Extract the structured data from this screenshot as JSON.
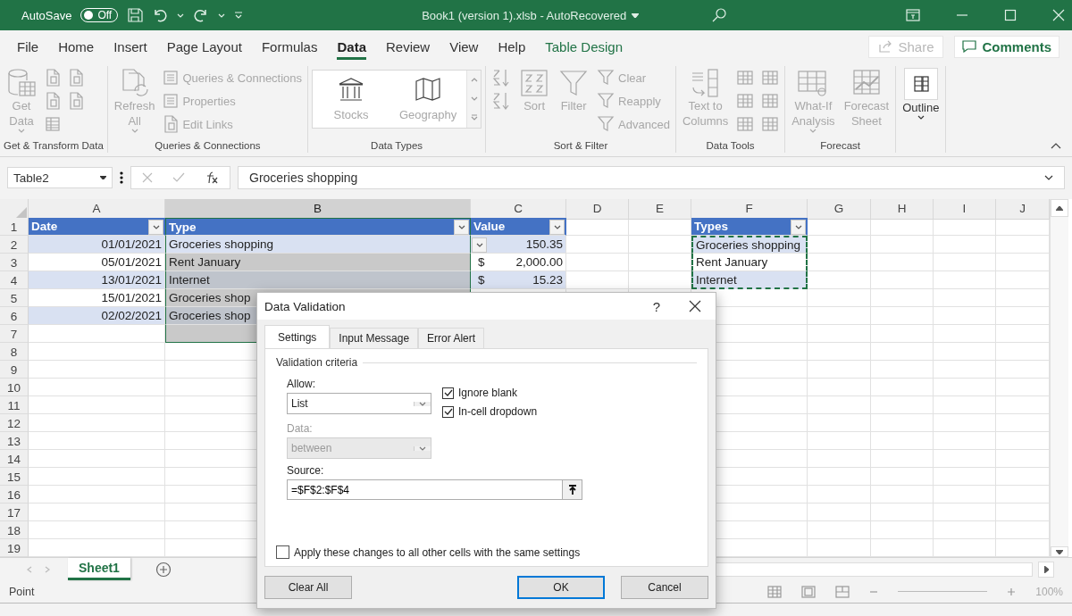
{
  "title_bar": {
    "autosave_label": "AutoSave",
    "autosave_toggle": {
      "label": "Off",
      "on": false
    },
    "title": "Book1 (version 1).xlsb  -  AutoRecovered"
  },
  "menu_tabs": [
    {
      "label": "File",
      "selected": false,
      "kind": "standard"
    },
    {
      "label": "Home",
      "selected": false,
      "kind": "standard"
    },
    {
      "label": "Insert",
      "selected": false,
      "kind": "standard"
    },
    {
      "label": "Page Layout",
      "selected": false,
      "kind": "standard"
    },
    {
      "label": "Formulas",
      "selected": false,
      "kind": "standard"
    },
    {
      "label": "Data",
      "selected": true,
      "kind": "standard"
    },
    {
      "label": "Review",
      "selected": false,
      "kind": "standard"
    },
    {
      "label": "View",
      "selected": false,
      "kind": "standard"
    },
    {
      "label": "Help",
      "selected": false,
      "kind": "standard"
    },
    {
      "label": "Table Design",
      "selected": false,
      "kind": "contextual"
    }
  ],
  "share_button": {
    "label": "Share",
    "disabled": true
  },
  "comments_button": {
    "label": "Comments"
  },
  "ribbon": [
    {
      "kind": "get-transform",
      "label": "Get & Transform Data",
      "commands": [
        {
          "kind": "large",
          "label": "Get\nData",
          "dropdown": true,
          "disabled": true
        },
        {
          "kind": "icon",
          "disabled": true
        },
        {
          "kind": "icon",
          "disabled": true
        },
        {
          "kind": "icon",
          "disabled": true
        },
        {
          "kind": "icon",
          "disabled": true
        },
        {
          "kind": "icon",
          "disabled": true
        }
      ]
    },
    {
      "kind": "queries",
      "label": "Queries & Connections",
      "commands": [
        {
          "kind": "large",
          "label": "Refresh\nAll",
          "dropdown": true,
          "disabled": true
        },
        {
          "kind": "small",
          "label": "Queries & Connections",
          "disabled": true
        },
        {
          "kind": "small",
          "label": "Properties",
          "disabled": true
        },
        {
          "kind": "small",
          "label": "Edit Links",
          "disabled": true
        }
      ]
    },
    {
      "kind": "data-types",
      "label": "Data Types",
      "commands": [
        {
          "kind": "gallery",
          "items": [
            {
              "label": "Stocks",
              "disabled": true
            },
            {
              "label": "Geography",
              "disabled": true
            }
          ]
        }
      ]
    },
    {
      "kind": "sort-filter",
      "label": "Sort & Filter",
      "commands": [
        {
          "kind": "icon",
          "disabled": true
        },
        {
          "kind": "icon",
          "disabled": true
        },
        {
          "kind": "large",
          "label": "Sort",
          "dropdown": false,
          "disabled": true
        },
        {
          "kind": "large",
          "label": "Filter",
          "dropdown": false,
          "disabled": true
        },
        {
          "kind": "small",
          "label": "Clear",
          "disabled": true
        },
        {
          "kind": "small",
          "label": "Reapply",
          "disabled": true
        },
        {
          "kind": "small",
          "label": "Advanced",
          "disabled": true
        }
      ]
    },
    {
      "kind": "data-tools",
      "label": "Data Tools",
      "commands": [
        {
          "kind": "large",
          "label": "Text to\nColumns",
          "dropdown": false,
          "disabled": true
        },
        {
          "kind": "icon",
          "disabled": true
        },
        {
          "kind": "icon",
          "disabled": true
        },
        {
          "kind": "icon",
          "disabled": true
        },
        {
          "kind": "icon",
          "disabled": true
        },
        {
          "kind": "icon",
          "disabled": true
        },
        {
          "kind": "icon",
          "disabled": true
        }
      ]
    },
    {
      "kind": "forecast",
      "label": "Forecast",
      "commands": [
        {
          "kind": "large",
          "label": "What-If\nAnalysis",
          "dropdown": true,
          "disabled": true
        },
        {
          "kind": "large",
          "label": "Forecast\nSheet",
          "dropdown": false,
          "disabled": true
        }
      ]
    },
    {
      "kind": "outline",
      "commands": [
        {
          "kind": "large",
          "label": "Outline",
          "dropdown": true,
          "disabled": false
        }
      ]
    }
  ],
  "formula_bar": {
    "name_box": "Table2",
    "formula": "Groceries shopping"
  },
  "sheet": {
    "columns": [
      {
        "label": "A",
        "selected": false
      },
      {
        "label": "B",
        "selected": true
      },
      {
        "label": "C",
        "selected": false
      },
      {
        "label": "D",
        "selected": false
      },
      {
        "label": "E",
        "selected": false
      },
      {
        "label": "F",
        "selected": false
      },
      {
        "label": "G",
        "selected": false
      },
      {
        "label": "H",
        "selected": false
      },
      {
        "label": "I",
        "selected": false
      },
      {
        "label": "J",
        "selected": false
      }
    ],
    "rows": [
      {
        "number": "1",
        "cells": [
          {
            "kind": "header",
            "text": "Date",
            "filter": true
          },
          {
            "kind": "header",
            "text": "Type",
            "filter": true,
            "selected": true
          },
          {
            "kind": "header",
            "text": "Value",
            "filter": true
          },
          {},
          {},
          {
            "kind": "header",
            "text": "Types",
            "filter": true
          }
        ]
      },
      {
        "number": "2",
        "cells": [
          {
            "kind": "number",
            "text": "01/01/2021",
            "banded": true
          },
          {
            "kind": "text",
            "text": "Groceries shopping",
            "banded": true,
            "selected": true,
            "active": true,
            "validation_dropdown": true
          },
          {
            "kind": "number",
            "text": "150.35",
            "banded": true
          },
          {},
          {},
          {
            "kind": "text",
            "text": "Groceries shopping",
            "banded": true,
            "marquee": true
          }
        ]
      },
      {
        "number": "3",
        "cells": [
          {
            "kind": "number",
            "text": "05/01/2021",
            "banded": false
          },
          {
            "kind": "text",
            "text": "Rent January",
            "banded": false,
            "selected": true,
            "active": false
          },
          {
            "kind": "currency",
            "symbol": "$",
            "text": "2,000.00",
            "banded": false
          },
          {},
          {},
          {
            "kind": "text",
            "text": "Rent January",
            "banded": false,
            "marquee": true
          }
        ]
      },
      {
        "number": "4",
        "cells": [
          {
            "kind": "number",
            "text": "13/01/2021",
            "banded": true
          },
          {
            "kind": "text",
            "text": "Internet",
            "banded": true,
            "selected": true,
            "active": false
          },
          {
            "kind": "currency",
            "symbol": "$",
            "text": "15.23",
            "banded": true
          },
          {},
          {},
          {
            "kind": "text",
            "text": "Internet",
            "banded": true,
            "marquee": true
          }
        ]
      },
      {
        "number": "5",
        "cells": [
          {
            "kind": "number",
            "text": "15/01/2021",
            "banded": false
          },
          {
            "kind": "text",
            "text": "Groceries shop",
            "banded": false,
            "selected": true,
            "active": false
          }
        ]
      },
      {
        "number": "6",
        "cells": [
          {
            "kind": "number",
            "text": "02/02/2021",
            "banded": true
          },
          {
            "kind": "text",
            "text": "Groceries shop",
            "banded": true,
            "selected": true,
            "active": false
          }
        ]
      },
      {
        "number": "7",
        "cells": [
          {},
          {
            "kind": "text",
            "selected": true,
            "active": false
          }
        ]
      },
      {
        "number": "8"
      },
      {
        "number": "9"
      },
      {
        "number": "10"
      },
      {
        "number": "11"
      },
      {
        "number": "12"
      },
      {
        "number": "13"
      },
      {
        "number": "14"
      },
      {
        "number": "15"
      },
      {
        "number": "16"
      },
      {
        "number": "17"
      },
      {
        "number": "18"
      },
      {
        "number": "19"
      }
    ],
    "sheet_tabs": [
      {
        "label": "Sheet1",
        "selected": true
      }
    ]
  },
  "status_bar": {
    "mode": "Point",
    "zoom": "100%"
  },
  "dialog": {
    "title": "Data Validation",
    "help": "?",
    "tabs": [
      {
        "label": "Settings",
        "selected": true
      },
      {
        "label": "Input Message",
        "selected": false
      },
      {
        "label": "Error Alert",
        "selected": false
      }
    ],
    "section": "Validation criteria",
    "allow": {
      "label": "Allow:",
      "value": "List",
      "disabled": false
    },
    "data": {
      "label": "Data:",
      "value": "between",
      "disabled": true
    },
    "checkboxes": [
      {
        "label": "Ignore blank",
        "checked": true
      },
      {
        "label": "In-cell dropdown",
        "checked": true
      }
    ],
    "source": {
      "label": "Source:",
      "value": "=$F$2:$F$4"
    },
    "apply_all": {
      "label": "Apply these changes to all other cells with the same settings",
      "checked": false
    },
    "buttons": [
      {
        "label": "Clear All",
        "kind": "secondary"
      },
      {
        "label": "OK",
        "kind": "default"
      },
      {
        "label": "Cancel",
        "kind": "secondary"
      }
    ]
  }
}
